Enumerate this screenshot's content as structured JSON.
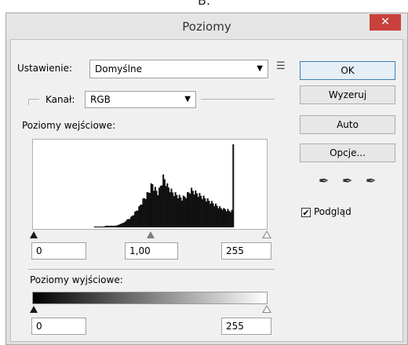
{
  "caption_fragment": "B.",
  "dialog": {
    "title": "Poziomy",
    "close_glyph": "✕"
  },
  "preset": {
    "label": "Ustawienie:",
    "value": "Domyślne",
    "menu_glyph": "☰"
  },
  "channel": {
    "label": "Kanał:",
    "value": "RGB"
  },
  "input_levels": {
    "label": "Poziomy wejściowe:",
    "black": "0",
    "gamma": "1,00",
    "white": "255",
    "histogram": [
      0,
      0,
      0,
      0,
      0,
      0,
      0,
      0,
      0,
      0,
      0,
      0,
      0,
      0,
      0,
      0,
      0,
      0,
      0,
      0,
      0,
      0,
      1,
      1,
      1,
      1,
      1,
      1,
      1,
      1,
      2,
      2,
      2,
      2,
      2,
      2,
      2,
      2,
      2,
      3,
      3,
      4,
      5,
      5,
      6,
      8,
      9,
      10,
      11,
      12,
      14,
      16,
      18,
      20,
      22,
      24,
      27,
      30,
      33,
      35,
      37,
      40,
      42,
      45,
      50,
      52,
      48,
      46,
      44,
      42,
      45,
      50,
      55,
      60,
      58,
      54,
      50,
      48,
      46,
      44,
      42,
      41,
      40,
      39,
      38,
      37,
      36,
      35,
      36,
      37,
      38,
      40,
      42,
      44,
      45,
      44,
      43,
      42,
      41,
      40,
      39,
      38,
      37,
      36,
      35,
      34,
      33,
      32,
      31,
      30,
      29,
      28,
      27,
      26,
      25,
      24,
      23,
      23,
      22,
      22,
      21,
      21,
      20,
      20,
      20,
      100
    ]
  },
  "output_levels": {
    "label": "Poziomy wyjściowe:",
    "black": "0",
    "white": "255"
  },
  "buttons": {
    "ok": "OK",
    "reset": "Wyzeruj",
    "auto": "Auto",
    "options": "Opcje..."
  },
  "preview": {
    "label": "Podgląd",
    "checked": true,
    "check_glyph": "✔"
  },
  "eyedroppers": [
    "black-point-eyedropper",
    "gray-point-eyedropper",
    "white-point-eyedropper"
  ]
}
